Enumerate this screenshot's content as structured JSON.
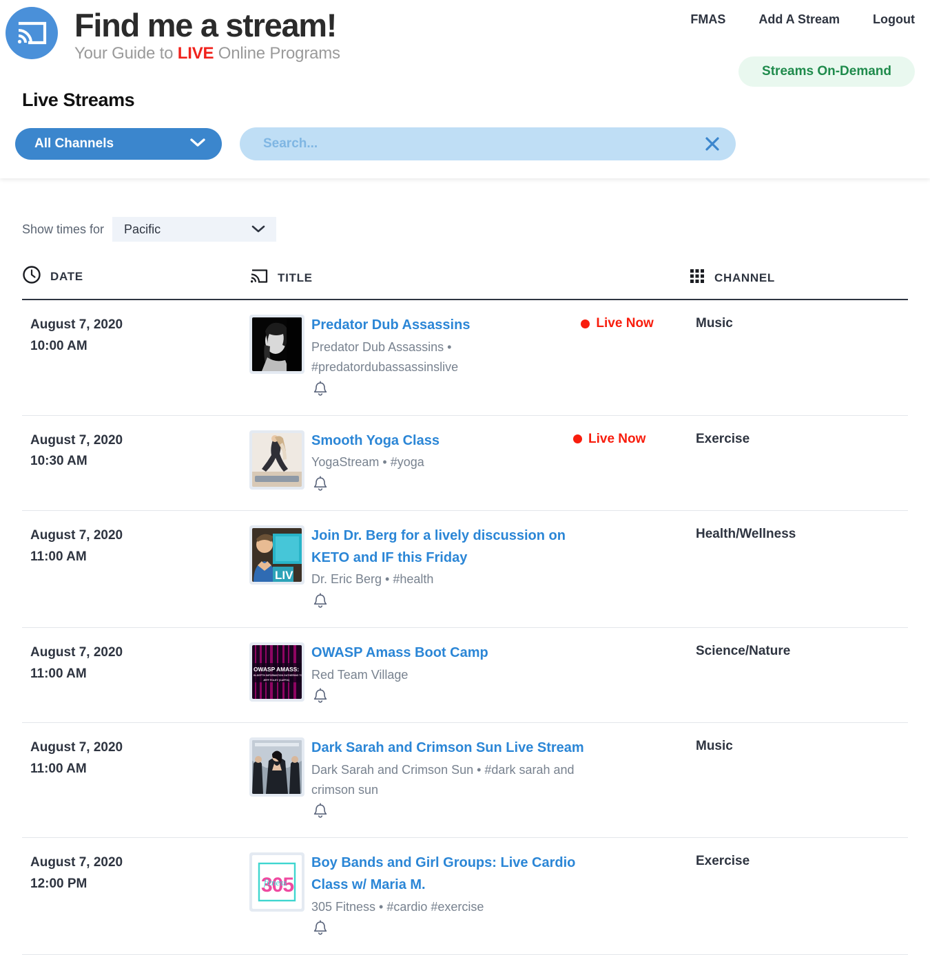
{
  "brand": {
    "logo_icon": "cast-stream-icon",
    "title": "Find me a stream!",
    "tagline_prefix": "Your Guide to ",
    "tagline_highlight": "LIVE",
    "tagline_suffix": " Online Programs",
    "highlight_color": "#f0221c"
  },
  "nav": {
    "items": [
      {
        "label": "FMAS"
      },
      {
        "label": "Add A Stream"
      },
      {
        "label": "Logout"
      }
    ],
    "ondemand_label": "Streams On-Demand",
    "ondemand_bg": "#e9f8ef",
    "ondemand_color": "#1f8b4c"
  },
  "page": {
    "section_title": "Live Streams"
  },
  "filters": {
    "channel_label": "All Channels",
    "channel_icon": "chevron-down-icon",
    "channel_bg": "#3b86cd",
    "search_value": "",
    "search_placeholder": "Search...",
    "search_bg": "#bfdef5",
    "clear_icon": "close-icon"
  },
  "timezone": {
    "label": "Show times for",
    "value": "Pacific",
    "icon": "chevron-down-icon"
  },
  "table": {
    "headers": [
      {
        "label": "DATE",
        "icon": "clock-icon"
      },
      {
        "label": "TITLE",
        "icon": "cast-stream-icon"
      },
      {
        "label": "CHANNEL",
        "icon": "grid-icon"
      }
    ],
    "rows": [
      {
        "date": "August 7, 2020",
        "time": "10:00 AM",
        "title": "Predator Dub Assassins",
        "meta": "Predator Dub Assassins • #predatordubassassinslive",
        "live_label": "Live Now",
        "is_live": true,
        "channel": "Music",
        "thumb": "portrait-bw",
        "bell_icon": "bell-icon"
      },
      {
        "date": "August 7, 2020",
        "time": "10:30 AM",
        "title": "Smooth Yoga Class",
        "meta": "YogaStream • #yoga",
        "live_label": "Live Now",
        "is_live": true,
        "channel": "Exercise",
        "thumb": "yoga",
        "bell_icon": "bell-icon"
      },
      {
        "date": "August 7, 2020",
        "time": "11:00 AM",
        "title": "Join Dr. Berg for a lively discussion on KETO and IF this Friday",
        "meta": "Dr. Eric Berg • #health",
        "live_label": "",
        "is_live": false,
        "channel": "Health/Wellness",
        "thumb": "berg",
        "bell_icon": "bell-icon"
      },
      {
        "date": "August 7, 2020",
        "time": "11:00 AM",
        "title": "OWASP Amass Boot Camp",
        "meta": "Red Team Village",
        "live_label": "",
        "is_live": false,
        "channel": "Science/Nature",
        "thumb": "owasp",
        "bell_icon": "bell-icon"
      },
      {
        "date": "August 7, 2020",
        "time": "11:00 AM",
        "title": "Dark Sarah and Crimson Sun Live Stream",
        "meta": "Dark Sarah and Crimson Sun • #dark sarah and crimson sun",
        "live_label": "",
        "is_live": false,
        "channel": "Music",
        "thumb": "band",
        "bell_icon": "bell-icon"
      },
      {
        "date": "August 7, 2020",
        "time": "12:00 PM",
        "title": "Boy Bands and Girl Groups: Live Cardio Class w/ Maria M.",
        "meta": "305 Fitness • #cardio #exercise",
        "live_label": "",
        "is_live": false,
        "channel": "Exercise",
        "thumb": "fitness305",
        "bell_icon": "bell-icon"
      }
    ]
  },
  "thumb_art": {
    "owasp_line1": "OWASP AMASS:",
    "owasp_line2": "IN-DEPTH INFORMATION GATHERING TOOL",
    "owasp_line3": "JEFF FOLEY (CAFFIX)",
    "berg_badge": "LIV",
    "fitness_number": "305",
    "fitness_script": "fitness"
  }
}
